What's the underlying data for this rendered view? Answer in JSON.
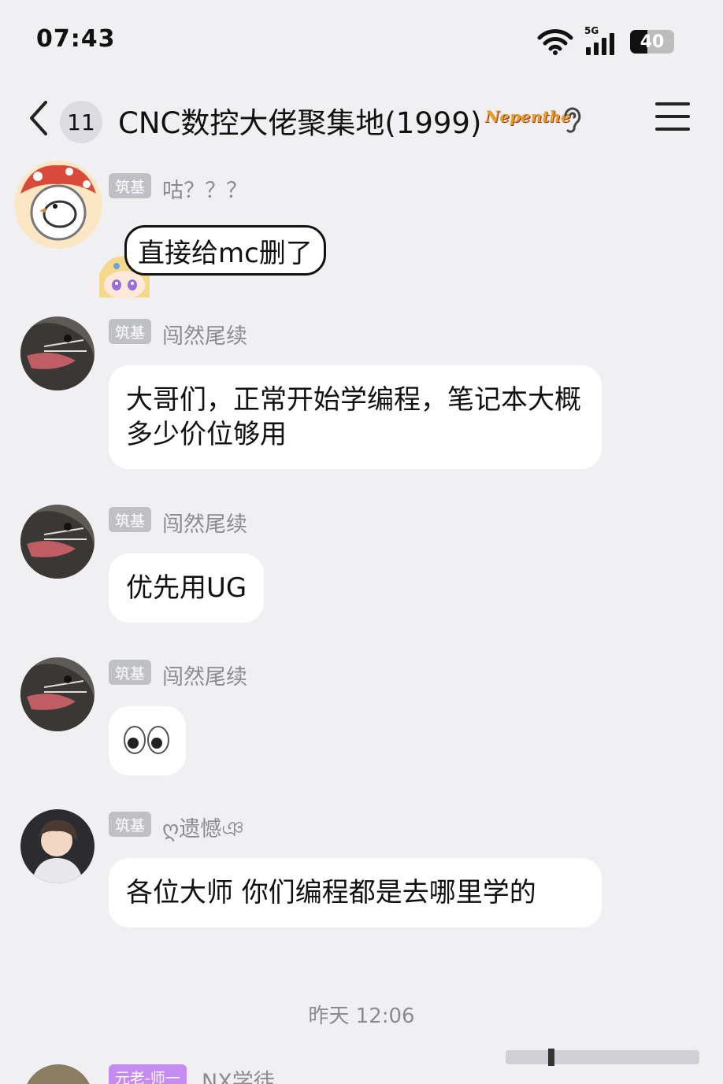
{
  "status_bar": {
    "time": "07:43",
    "network": "5G",
    "battery": "40",
    "battery_level": 0.4
  },
  "nav": {
    "unread_count": "11",
    "title": "CNC数控大佬聚集地(1999)",
    "badge_text": "Nepenthe"
  },
  "messages": [
    {
      "rank": "筑基",
      "name": "咕？？？",
      "sticker_text": "直接给mc删了"
    },
    {
      "rank": "筑基",
      "name": "闯然尾续",
      "text": "大哥们，正常开始学编程，笔记本大概多少价位够用"
    },
    {
      "rank": "筑基",
      "name": "闯然尾续",
      "text": "优先用UG"
    },
    {
      "rank": "筑基",
      "name": "闯然尾续",
      "text": "👀"
    },
    {
      "rank": "筑基",
      "name": "ღ遗憾ঞ",
      "text": "各位大师 你们编程都是去哪里学的"
    },
    {
      "rank": "元老-师一",
      "name": "NX学徒"
    }
  ],
  "divider": {
    "time": "昨天 12:06"
  },
  "colors": {
    "background": "#f0f0f3",
    "bubble": "#ffffff",
    "rank_tag": "#bfbfc6",
    "rank_tag_elder": "#c58cf0",
    "meta_text": "#8b8b92"
  }
}
